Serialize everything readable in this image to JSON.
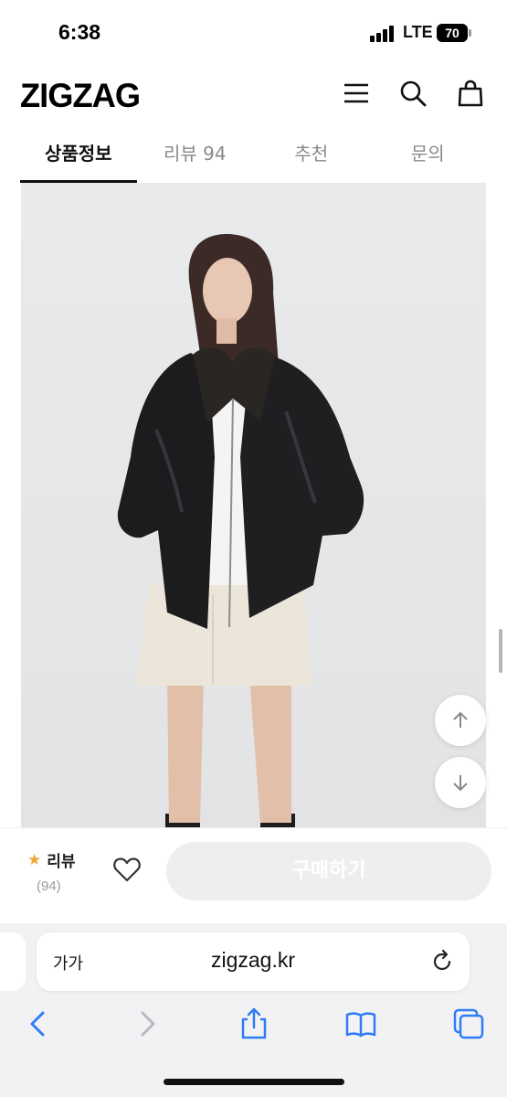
{
  "status_bar": {
    "time": "6:38",
    "network": "LTE",
    "battery": "70"
  },
  "header": {
    "logo": "ZIGZAG",
    "icons": [
      "menu-icon",
      "search-icon",
      "shopping-bag-icon"
    ]
  },
  "tabs": [
    {
      "label": "상품정보",
      "active": true
    },
    {
      "label": "리뷰 94",
      "active": false
    },
    {
      "label": "추천",
      "active": false
    },
    {
      "label": "문의",
      "active": false
    }
  ],
  "scroll_buttons": {
    "up_icon": "arrow-up-icon",
    "down_icon": "arrow-down-icon"
  },
  "buy_bar": {
    "review_label": "리뷰",
    "review_count": "(94)",
    "buy_label": "구매하기",
    "accent": "#f3a33b"
  },
  "browser": {
    "text_size_label": "가가",
    "url": "zigzag.kr"
  }
}
